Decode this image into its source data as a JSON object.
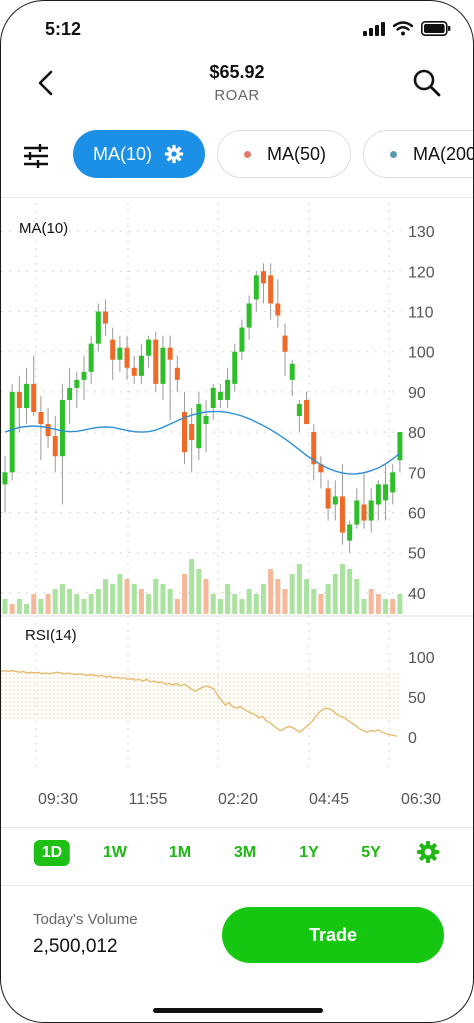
{
  "status_bar": {
    "time": "5:12"
  },
  "header": {
    "price": "$65.92",
    "ticker": "ROAR"
  },
  "indicators": [
    {
      "label": "MA(10)",
      "active": true
    },
    {
      "label": "MA(50)",
      "dot_color": "#e07a6a"
    },
    {
      "label": "MA(200)",
      "dot_color": "#5a9bb0"
    }
  ],
  "price_panel": {
    "label": "MA(10)",
    "y_ticks": [
      130,
      120,
      110,
      100,
      90,
      80,
      70,
      60,
      50,
      40
    ],
    "ylim": [
      35,
      135
    ]
  },
  "rsi_panel": {
    "label": "RSI(14)",
    "y_ticks": [
      100,
      50,
      0
    ],
    "band": [
      20,
      80
    ]
  },
  "time_axis": [
    "09:30",
    "11:55",
    "02:20",
    "04:45",
    "06:30"
  ],
  "time_ranges": [
    {
      "label": "1D",
      "selected": true
    },
    {
      "label": "1W"
    },
    {
      "label": "1M"
    },
    {
      "label": "3M"
    },
    {
      "label": "1Y"
    },
    {
      "label": "5Y"
    }
  ],
  "volume": {
    "label": "Today's Volume",
    "value": "2,500,012"
  },
  "trade_button": {
    "label": "Trade"
  },
  "colors": {
    "up": "#2dbe2a",
    "down": "#ee6a26",
    "ma_line": "#2c8fd8",
    "rsi_line": "#e8b866",
    "accent": "#1c8fe6",
    "brand": "#15c710"
  },
  "chart_data": [
    {
      "type": "candlestick",
      "title": "MA(10)",
      "ylim": [
        35,
        135
      ],
      "candles": [
        {
          "o": 67,
          "h": 74,
          "l": 60,
          "c": 70
        },
        {
          "o": 70,
          "h": 92,
          "l": 68,
          "c": 90
        },
        {
          "o": 90,
          "h": 94,
          "l": 80,
          "c": 86
        },
        {
          "o": 86,
          "h": 96,
          "l": 82,
          "c": 92
        },
        {
          "o": 92,
          "h": 99,
          "l": 84,
          "c": 85
        },
        {
          "o": 85,
          "h": 89,
          "l": 73,
          "c": 82
        },
        {
          "o": 82,
          "h": 86,
          "l": 76,
          "c": 79
        },
        {
          "o": 79,
          "h": 84,
          "l": 70,
          "c": 74
        },
        {
          "o": 74,
          "h": 92,
          "l": 62,
          "c": 88
        },
        {
          "o": 88,
          "h": 96,
          "l": 82,
          "c": 91
        },
        {
          "o": 91,
          "h": 95,
          "l": 86,
          "c": 93
        },
        {
          "o": 93,
          "h": 99,
          "l": 88,
          "c": 95
        },
        {
          "o": 95,
          "h": 104,
          "l": 92,
          "c": 102
        },
        {
          "o": 102,
          "h": 112,
          "l": 100,
          "c": 110
        },
        {
          "o": 110,
          "h": 113,
          "l": 104,
          "c": 107
        },
        {
          "o": 103,
          "h": 106,
          "l": 93,
          "c": 98
        },
        {
          "o": 98,
          "h": 104,
          "l": 95,
          "c": 101
        },
        {
          "o": 101,
          "h": 104,
          "l": 93,
          "c": 96
        },
        {
          "o": 96,
          "h": 99,
          "l": 92,
          "c": 94
        },
        {
          "o": 94,
          "h": 102,
          "l": 92,
          "c": 99
        },
        {
          "o": 99,
          "h": 104,
          "l": 96,
          "c": 103
        },
        {
          "o": 103,
          "h": 105,
          "l": 90,
          "c": 92
        },
        {
          "o": 92,
          "h": 104,
          "l": 88,
          "c": 101
        },
        {
          "o": 101,
          "h": 104,
          "l": 83,
          "c": 98
        },
        {
          "o": 96,
          "h": 99,
          "l": 90,
          "c": 93
        },
        {
          "o": 85,
          "h": 90,
          "l": 72,
          "c": 75
        },
        {
          "o": 82,
          "h": 86,
          "l": 70,
          "c": 78
        },
        {
          "o": 76,
          "h": 90,
          "l": 73,
          "c": 87
        },
        {
          "o": 82,
          "h": 88,
          "l": 75,
          "c": 84
        },
        {
          "o": 86,
          "h": 92,
          "l": 83,
          "c": 91
        },
        {
          "o": 88,
          "h": 92,
          "l": 86,
          "c": 90
        },
        {
          "o": 88,
          "h": 96,
          "l": 86,
          "c": 93
        },
        {
          "o": 92,
          "h": 102,
          "l": 90,
          "c": 100
        },
        {
          "o": 100,
          "h": 108,
          "l": 98,
          "c": 106
        },
        {
          "o": 106,
          "h": 114,
          "l": 103,
          "c": 112
        },
        {
          "o": 113,
          "h": 120,
          "l": 110,
          "c": 119
        },
        {
          "o": 120,
          "h": 122,
          "l": 112,
          "c": 117
        },
        {
          "o": 119,
          "h": 122,
          "l": 108,
          "c": 112
        },
        {
          "o": 112,
          "h": 118,
          "l": 106,
          "c": 109
        },
        {
          "o": 104,
          "h": 107,
          "l": 94,
          "c": 100
        },
        {
          "o": 93,
          "h": 98,
          "l": 89,
          "c": 97
        },
        {
          "o": 84,
          "h": 88,
          "l": 80,
          "c": 87
        },
        {
          "o": 88,
          "h": 90,
          "l": 82,
          "c": 82
        },
        {
          "o": 80,
          "h": 82,
          "l": 68,
          "c": 72
        },
        {
          "o": 72,
          "h": 74,
          "l": 66,
          "c": 70
        },
        {
          "o": 66,
          "h": 68,
          "l": 58,
          "c": 61
        },
        {
          "o": 62,
          "h": 68,
          "l": 58,
          "c": 64
        },
        {
          "o": 64,
          "h": 72,
          "l": 52,
          "c": 55
        },
        {
          "o": 53,
          "h": 58,
          "l": 50,
          "c": 57
        },
        {
          "o": 57,
          "h": 66,
          "l": 56,
          "c": 63
        },
        {
          "o": 62,
          "h": 70,
          "l": 56,
          "c": 58
        },
        {
          "o": 58,
          "h": 66,
          "l": 55,
          "c": 63
        },
        {
          "o": 62,
          "h": 68,
          "l": 58,
          "c": 67
        },
        {
          "o": 63,
          "h": 72,
          "l": 58,
          "c": 67
        },
        {
          "o": 65,
          "h": 72,
          "l": 62,
          "c": 70
        },
        {
          "o": 73,
          "h": 80,
          "l": 70,
          "c": 80
        }
      ],
      "ma10": [
        80,
        80.6,
        81.2,
        81.4,
        81.5,
        81.4,
        81.1,
        80.7,
        80.3,
        80.1,
        80.2,
        80.5,
        80.9,
        81.2,
        81.3,
        81.2,
        80.8,
        80.4,
        80.1,
        80,
        80.1,
        80.5,
        81.2,
        82,
        82.8,
        83.6,
        84.2,
        84.7,
        85,
        85.1,
        85.1,
        84.9,
        84.5,
        84,
        83.3,
        82.5,
        81.6,
        80.6,
        79.5,
        78.3,
        77,
        75.6,
        74.2,
        73,
        71.9,
        71,
        70.3,
        69.8,
        69.6,
        69.6,
        69.9,
        70.4,
        71.1,
        72.1,
        73.3,
        74.8
      ]
    },
    {
      "type": "bar",
      "title": "Volume",
      "values": [
        3,
        2,
        3,
        2,
        4,
        3,
        4,
        5,
        6,
        5,
        4,
        3,
        4,
        5,
        7,
        6,
        8,
        7,
        6,
        5,
        4,
        7,
        6,
        5,
        3,
        8,
        11,
        9,
        7,
        4,
        3,
        6,
        4,
        3,
        5,
        4,
        6,
        9,
        7,
        5,
        8,
        10,
        7,
        5,
        4,
        6,
        8,
        10,
        9,
        7,
        3,
        5,
        4,
        3,
        3,
        4
      ],
      "colors": [
        "g",
        "r",
        "g",
        "g",
        "r",
        "g",
        "r",
        "g",
        "g",
        "g",
        "g",
        "g",
        "g",
        "g",
        "g",
        "g",
        "g",
        "r",
        "g",
        "r",
        "g",
        "g",
        "g",
        "g",
        "r",
        "r",
        "g",
        "g",
        "r",
        "g",
        "g",
        "g",
        "g",
        "g",
        "g",
        "g",
        "g",
        "r",
        "r",
        "r",
        "g",
        "g",
        "g",
        "g",
        "r",
        "g",
        "g",
        "g",
        "g",
        "g",
        "g",
        "r",
        "r",
        "g",
        "r",
        "g"
      ]
    },
    {
      "type": "line",
      "title": "RSI(14)",
      "ylim": [
        0,
        100
      ],
      "values": [
        82,
        83,
        82,
        83,
        82,
        81,
        82,
        80,
        81,
        80,
        81,
        79,
        80,
        79,
        80,
        81,
        80,
        79,
        80,
        79,
        78,
        79,
        78,
        77,
        78,
        77,
        76,
        77,
        75,
        76,
        74,
        75,
        73,
        74,
        72,
        73,
        71,
        72,
        70,
        72,
        69,
        70,
        68,
        69,
        66,
        67,
        65,
        67,
        64,
        66,
        63,
        60,
        57,
        60,
        62,
        64,
        62,
        60,
        52,
        46,
        40,
        43,
        38,
        36,
        38,
        35,
        32,
        30,
        28,
        24,
        26,
        20,
        18,
        14,
        10,
        8,
        11,
        13,
        12,
        9,
        6,
        10,
        14,
        18,
        24,
        30,
        34,
        36,
        35,
        32,
        28,
        26,
        24,
        20,
        17,
        14,
        10,
        8,
        6,
        8,
        7,
        9,
        6,
        4,
        3,
        2,
        1
      ]
    }
  ]
}
